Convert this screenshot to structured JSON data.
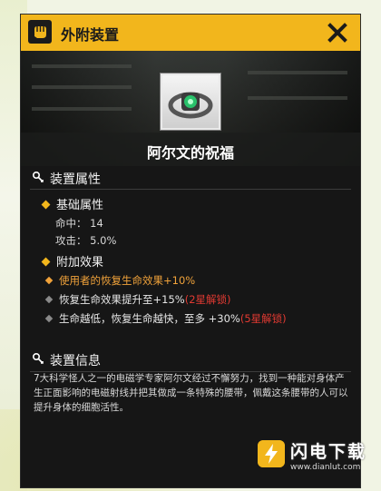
{
  "dialog": {
    "title": "外附装置",
    "close_icon": "close-x-icon",
    "title_icon": "fist-icon",
    "accent_color": "#f2b61c"
  },
  "item": {
    "name": "阿尔文的祝福",
    "icon": "belt-device-icon"
  },
  "attributes": {
    "header": "装置属性",
    "base_header": "基础属性",
    "stats": [
      {
        "label": "命中：",
        "value": "14"
      },
      {
        "label": "攻击：",
        "value": "5.0%"
      }
    ],
    "effects_header": "附加效果",
    "effects": [
      {
        "text": "使用者的恢复生命效果+10%",
        "lock": "",
        "active": true
      },
      {
        "text": "恢复生命效果提升至+15%",
        "lock": "(2星解锁)",
        "active": false
      },
      {
        "text": "生命越低，恢复生命越快，至多 +30%",
        "lock": "(5星解锁)",
        "active": false
      }
    ]
  },
  "info": {
    "header": "装置信息",
    "description": "7大科学怪人之一的电磁学专家阿尔文经过不懈努力，找到一种能对身体产生正面影响的电磁射线并把其做成一条特殊的腰带，佩戴这条腰带的人可以提升身体的细胞活性。"
  },
  "watermark": {
    "text": "闪电下载",
    "url": "www.dianlut.com"
  }
}
